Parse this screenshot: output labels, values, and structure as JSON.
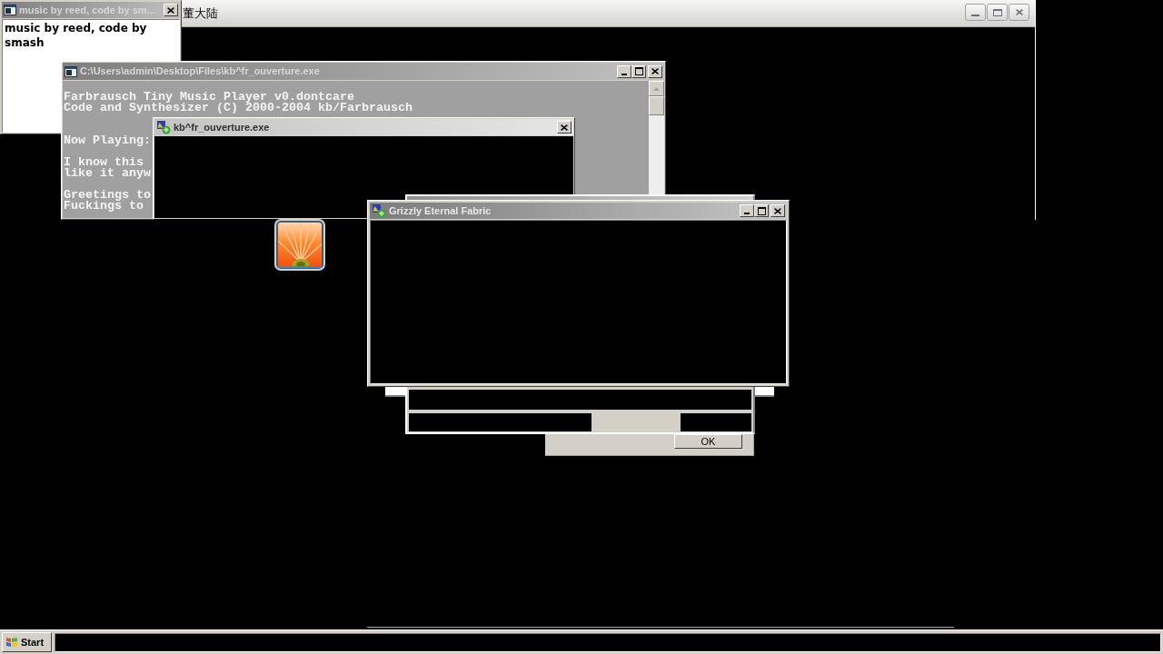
{
  "back_window": {
    "title": "董大陆"
  },
  "credits_window": {
    "title": "music by reed, code by sm...",
    "text": "music by reed, code by smash"
  },
  "console_window": {
    "title": "C:\\Users\\admin\\Desktop\\Files\\kb^fr_ouverture.exe",
    "header": [
      "Farbrausch Tiny Music Player v0.dontcare",
      "Code and Synthesizer (C) 2000-2004 kb/Farbrausch"
    ],
    "paragraphs": [
      [
        "Now Playing:"
      ],
      [
        "I know this",
        "like it anyw"
      ],
      [
        "Greetings to",
        "Fuckings to"
      ]
    ]
  },
  "player_window": {
    "title": "kb^fr_ouverture.exe"
  },
  "grizzly_window": {
    "title": "Grizzly Eternal Fabric"
  },
  "dialog": {
    "button": "OK"
  },
  "taskbar": {
    "start_button": "Start"
  }
}
